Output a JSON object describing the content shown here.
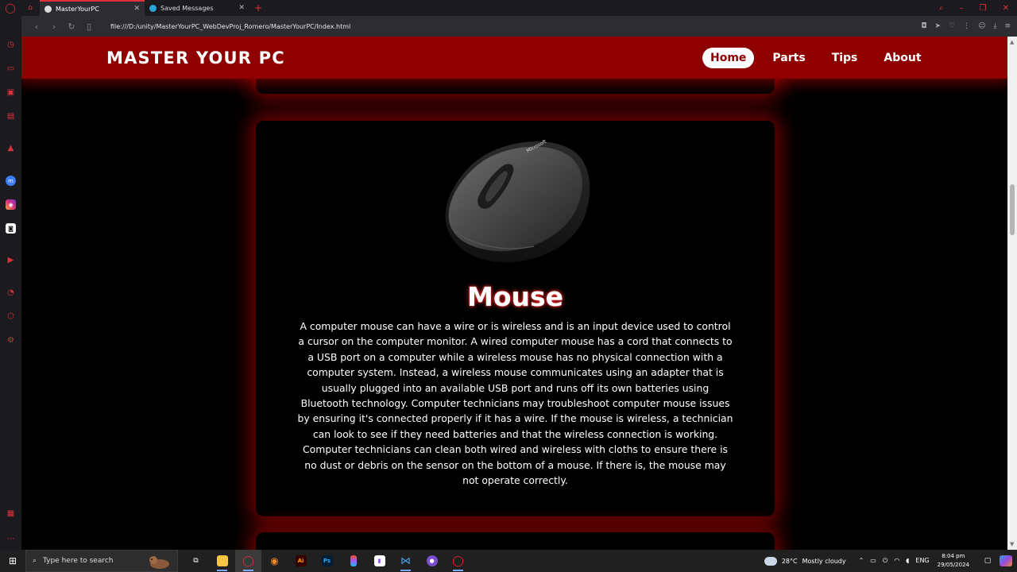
{
  "browser": {
    "tabs": [
      {
        "title": "MasterYourPC",
        "active": true
      },
      {
        "title": "Saved Messages",
        "active": false
      }
    ],
    "url": "file:///D:/unity/MasterYourPC_WebDevProj_Romero/MasterYourPC/Index.html"
  },
  "site": {
    "brand": "MASTER YOUR PC",
    "nav": [
      {
        "label": "Home",
        "active": true
      },
      {
        "label": "Parts",
        "active": false
      },
      {
        "label": "Tips",
        "active": false
      },
      {
        "label": "About",
        "active": false
      }
    ],
    "card": {
      "title": "Mouse",
      "text": "A computer mouse can have a wire or is wireless and is an input device used to control a cursor on the computer monitor. A wired computer mouse has a cord that connects to a USB port on a computer while a wireless mouse has no physical connection with a computer system. Instead, a wireless mouse communicates using an adapter that is usually plugged into an available USB port and runs off its own batteries using Bluetooth technology. Computer technicians may troubleshoot computer mouse issues by ensuring it's connected properly if it has a wire. If the mouse is wireless, a technician can look to see if they need batteries and that the wireless connection is working. Computer technicians can clean both wired and wireless with cloths to ensure there is no dust or debris on the sensor on the bottom of a mouse. If there is, the mouse may not operate correctly.",
      "image_brand_text": "Microsoft"
    },
    "colors": {
      "header": "#8f0000",
      "glow": "#ff0000",
      "background": "#000000"
    }
  },
  "taskbar": {
    "search_placeholder": "Type here to search",
    "weather": {
      "temp": "28°C",
      "condition": "Mostly cloudy"
    },
    "language": "ENG",
    "time": "8:04 pm",
    "date": "29/05/2024",
    "apps": [
      "task-view-icon",
      "file-explorer-icon",
      "opera-icon",
      "blender-icon",
      "illustrator-icon",
      "photoshop-icon",
      "figma-icon",
      "twitch-icon",
      "vscode-icon",
      "github-desktop-icon",
      "opera-gx-icon"
    ],
    "app_labels": {
      "illustrator": "Ai",
      "photoshop": "Ps"
    }
  }
}
